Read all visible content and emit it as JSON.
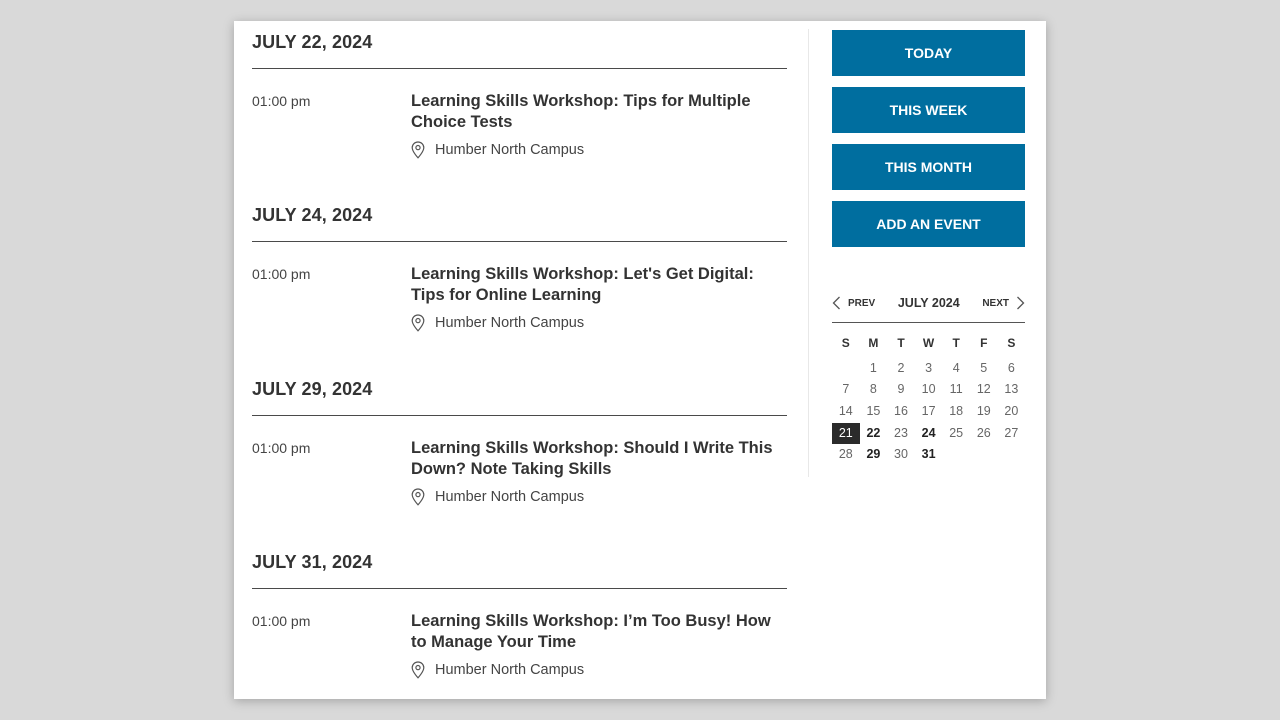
{
  "days": [
    {
      "heading": "JULY 22, 2024",
      "events": [
        {
          "time": "01:00 pm",
          "title": "Learning Skills Workshop: Tips for Multiple Choice Tests",
          "location": "Humber North Campus"
        }
      ]
    },
    {
      "heading": "JULY 24, 2024",
      "events": [
        {
          "time": "01:00 pm",
          "title": "Learning Skills Workshop: Let's Get Digital: Tips for Online Learning",
          "location": "Humber North Campus"
        }
      ]
    },
    {
      "heading": "JULY 29, 2024",
      "events": [
        {
          "time": "01:00 pm",
          "title": "Learning Skills Workshop: Should I Write This Down? Note Taking Skills",
          "location": "Humber North Campus"
        }
      ]
    },
    {
      "heading": "JULY 31, 2024",
      "events": [
        {
          "time": "01:00 pm",
          "title": "Learning Skills Workshop: I’m Too Busy! How to Manage Your Time",
          "location": "Humber North Campus"
        }
      ]
    }
  ],
  "sidebar": {
    "buttons": [
      "TODAY",
      "THIS WEEK",
      "THIS MONTH",
      "ADD AN EVENT"
    ],
    "accent_color": "#006e9f"
  },
  "calendar": {
    "prev_label": "PREV",
    "next_label": "NEXT",
    "month_label": "JULY 2024",
    "weekdays": [
      "S",
      "M",
      "T",
      "W",
      "T",
      "F",
      "S"
    ],
    "leading_blanks": 1,
    "days_in_month": 31,
    "today": 21,
    "event_days": [
      22,
      24,
      29,
      31
    ]
  }
}
